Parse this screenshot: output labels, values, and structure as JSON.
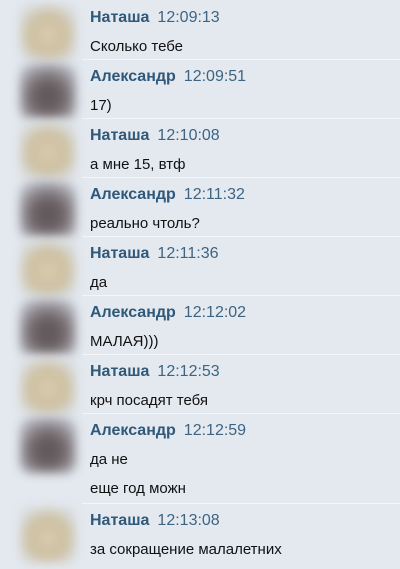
{
  "messages": [
    {
      "author": "Наташа",
      "time": "12:09:13",
      "lines": [
        "Сколько тебе"
      ]
    },
    {
      "author": "Александр",
      "time": "12:09:51",
      "lines": [
        "17)"
      ]
    },
    {
      "author": "Наташа",
      "time": "12:10:08",
      "lines": [
        "а мне 15, втф"
      ]
    },
    {
      "author": "Александр",
      "time": "12:11:32",
      "lines": [
        "реально чтоль?"
      ]
    },
    {
      "author": "Наташа",
      "time": "12:11:36",
      "lines": [
        "да"
      ]
    },
    {
      "author": "Александр",
      "time": "12:12:02",
      "lines": [
        "МАЛАЯ)))"
      ]
    },
    {
      "author": "Наташа",
      "time": "12:12:53",
      "lines": [
        "крч посадят тебя"
      ]
    },
    {
      "author": "Александр",
      "time": "12:12:59",
      "lines": [
        "да не",
        "еще год можн"
      ]
    },
    {
      "author": "Наташа",
      "time": "12:13:08",
      "lines": [
        "за сокращение малалетних"
      ]
    }
  ]
}
